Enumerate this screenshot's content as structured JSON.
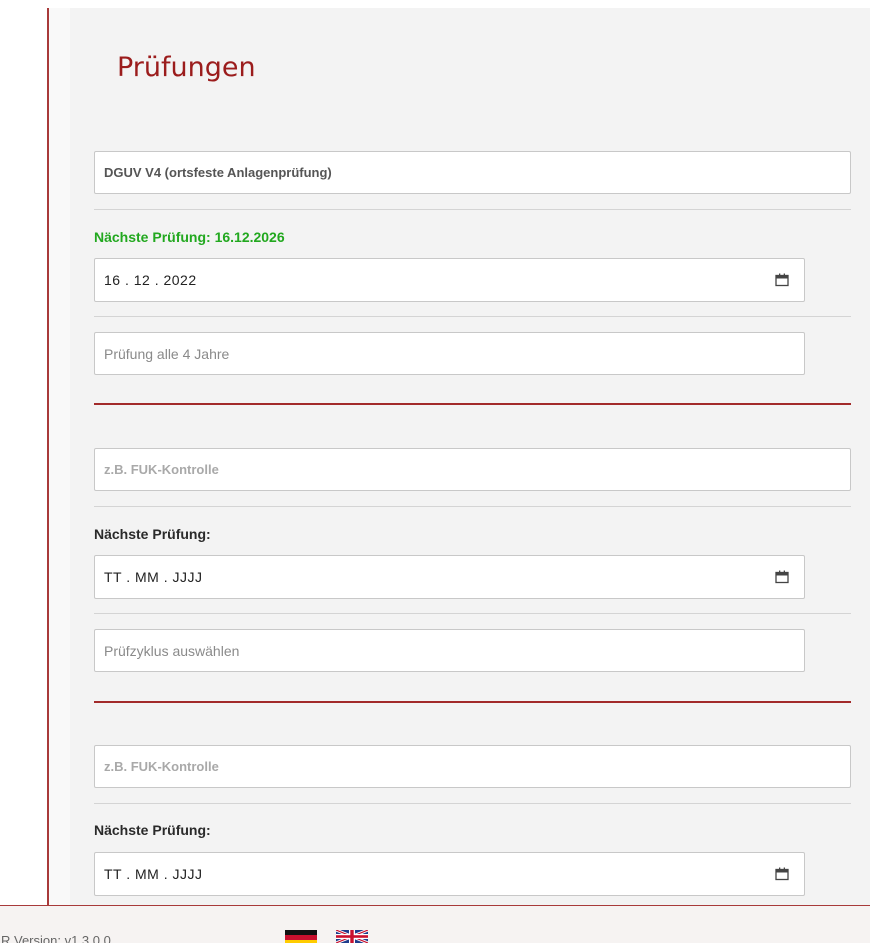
{
  "section": {
    "title": "Prüfungen"
  },
  "inspections": [
    {
      "name_value": "DGUV V4 (ortsfeste Anlagenprüfung)",
      "next_label": "Nächste Prüfung: 16.12.2026",
      "date_value": "16 . 12 . 2022",
      "cycle_value": "Prüfung alle 4 Jahre"
    },
    {
      "name_placeholder": "z.B. FUK-Kontrolle",
      "next_label": "Nächste Prüfung:",
      "date_placeholder": "TT . MM . JJJJ",
      "cycle_placeholder": "Prüfzyklus auswählen"
    },
    {
      "name_placeholder": "z.B. FUK-Kontrolle",
      "next_label": "Nächste Prüfung:",
      "date_placeholder": "TT . MM . JJJJ"
    }
  ],
  "footer": {
    "version": "R Version: v1.3.0.0"
  },
  "icons": {
    "calendar": "calendar-icon",
    "flag_de": "flag-de-icon",
    "flag_uk": "flag-uk-icon"
  },
  "colors": {
    "title": "#9b1c1c",
    "next_due_ok": "#22a81f",
    "accent_divider": "#a22a2a",
    "card_bg": "#f3f3f3"
  }
}
